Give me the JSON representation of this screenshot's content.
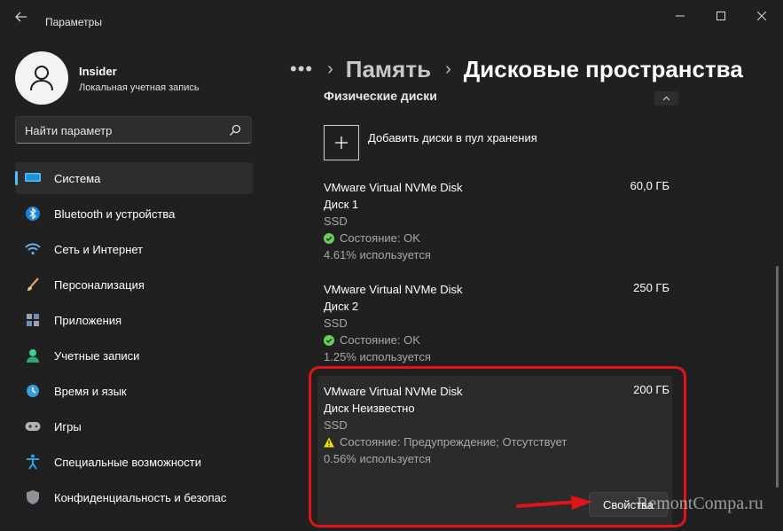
{
  "window": {
    "title": "Параметры",
    "back_icon": "arrow-left-icon",
    "controls": [
      "minimize-icon",
      "maximize-icon",
      "close-icon"
    ]
  },
  "user": {
    "name": "Insider",
    "account_type": "Локальная учетная запись"
  },
  "search": {
    "placeholder": "Найти параметр"
  },
  "sidebar": {
    "accent": "#4cc2ff",
    "items": [
      {
        "label": "Система",
        "icon": "system-icon",
        "active": true
      },
      {
        "label": "Bluetooth и устройства",
        "icon": "bluetooth-icon"
      },
      {
        "label": "Сеть и Интернет",
        "icon": "wifi-icon"
      },
      {
        "label": "Персонализация",
        "icon": "brush-icon"
      },
      {
        "label": "Приложения",
        "icon": "apps-icon"
      },
      {
        "label": "Учетные записи",
        "icon": "accounts-icon"
      },
      {
        "label": "Время и язык",
        "icon": "time-language-icon"
      },
      {
        "label": "Игры",
        "icon": "gamepad-icon"
      },
      {
        "label": "Специальные возможности",
        "icon": "accessibility-icon"
      },
      {
        "label": "Конфиденциальность и безопас",
        "icon": "shield-icon"
      }
    ]
  },
  "breadcrumb": {
    "more": "•••",
    "parent": "Память",
    "current": "Дисковые пространства"
  },
  "physical_disks": {
    "section_title": "Физические диски",
    "add_label": "Добавить диски в пул хранения",
    "disks": [
      {
        "name": "VMware Virtual NVMe Disk",
        "size": "60,0 ГБ",
        "label": "Диск 1",
        "type": "SSD",
        "status": "Состояние: OK",
        "status_kind": "ok",
        "usage": "4.61% используется"
      },
      {
        "name": "VMware Virtual NVMe Disk",
        "size": "250 ГБ",
        "label": "Диск 2",
        "type": "SSD",
        "status": "Состояние: OK",
        "status_kind": "ok",
        "usage": "1.25% используется"
      },
      {
        "name": "VMware Virtual NVMe Disk",
        "size": "200 ГБ",
        "label": "Диск Неизвестно",
        "type": "SSD",
        "status": "Состояние: Предупреждение; Отсутствует",
        "status_kind": "warning",
        "usage": "0.56% используется"
      }
    ],
    "properties_button": "Свойства"
  },
  "colors": {
    "ok": "#6ccb5f",
    "warning": "#fce100",
    "highlight": "#e0151b"
  },
  "watermark": "RemontCompa.ru"
}
